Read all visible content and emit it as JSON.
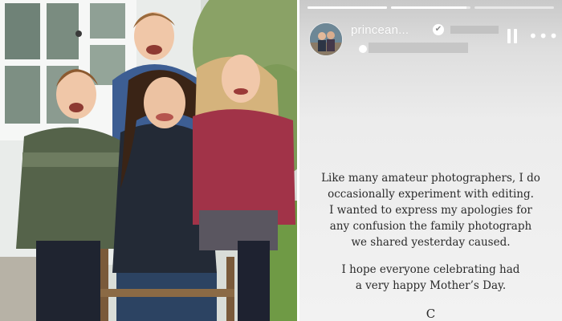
{
  "story": {
    "username": "princean...",
    "verified_glyph": "✔",
    "pause_button": "pause-icon",
    "more_button_glyph": "•••",
    "progress": [
      1.0,
      0.95,
      0.0
    ],
    "message_lines_1": [
      "Like many amateur photographers, I do",
      "occasionally experiment with editing.",
      "I wanted to express my apologies for",
      "any confusion the family photograph",
      "we shared yesterday caused."
    ],
    "message_lines_2": [
      "I hope everyone celebrating had",
      "a very happy Mother’s Day."
    ],
    "signoff": "C"
  },
  "icons": {
    "avatar": "profile-avatar",
    "verified": "verified-badge-icon",
    "pause": "pause-icon",
    "more": "more-options-icon"
  },
  "colors": {
    "story_text": "#2b2b2b",
    "header_text": "#ffffff"
  }
}
